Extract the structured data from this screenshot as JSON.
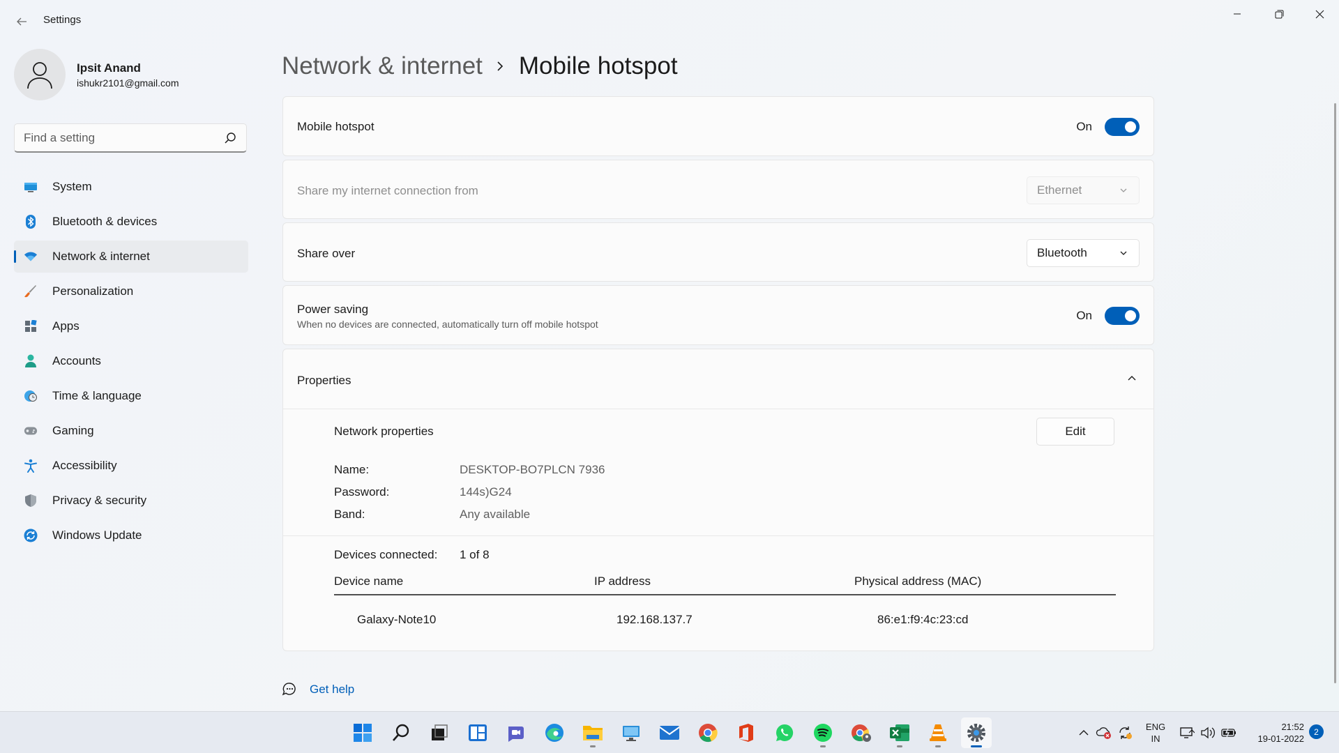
{
  "window": {
    "title": "Settings"
  },
  "profile": {
    "name": "Ipsit Anand",
    "email": "ishukr2101@gmail.com"
  },
  "search": {
    "placeholder": "Find a setting"
  },
  "nav": {
    "items": [
      {
        "label": "System",
        "icon": "monitor-icon"
      },
      {
        "label": "Bluetooth & devices",
        "icon": "bluetooth-icon"
      },
      {
        "label": "Network & internet",
        "icon": "wifi-icon",
        "active": true
      },
      {
        "label": "Personalization",
        "icon": "brush-icon"
      },
      {
        "label": "Apps",
        "icon": "apps-icon"
      },
      {
        "label": "Accounts",
        "icon": "person-icon"
      },
      {
        "label": "Time & language",
        "icon": "clock-globe-icon"
      },
      {
        "label": "Gaming",
        "icon": "gamepad-icon"
      },
      {
        "label": "Accessibility",
        "icon": "accessibility-icon"
      },
      {
        "label": "Privacy & security",
        "icon": "shield-icon"
      },
      {
        "label": "Windows Update",
        "icon": "update-icon"
      }
    ]
  },
  "breadcrumb": {
    "parent": "Network & internet",
    "current": "Mobile hotspot"
  },
  "hotspot": {
    "label": "Mobile hotspot",
    "state": "On"
  },
  "share_from": {
    "label": "Share my internet connection from",
    "value": "Ethernet"
  },
  "share_over": {
    "label": "Share over",
    "value": "Bluetooth"
  },
  "power_saving": {
    "label": "Power saving",
    "description": "When no devices are connected, automatically turn off mobile hotspot",
    "state": "On"
  },
  "properties": {
    "title": "Properties",
    "network_title": "Network properties",
    "edit_label": "Edit",
    "name_label": "Name:",
    "name_value": "DESKTOP-BO7PLCN 7936",
    "password_label": "Password:",
    "password_value": "144s)G24",
    "band_label": "Band:",
    "band_value": "Any available",
    "devices_label": "Devices connected:",
    "devices_value": "1 of 8",
    "columns": [
      "Device name",
      "IP address",
      "Physical address (MAC)"
    ],
    "rows": [
      {
        "device": "Galaxy-Note10",
        "ip": "192.168.137.7",
        "mac": "86:e1:f9:4c:23:cd"
      }
    ]
  },
  "help": {
    "label": "Get help"
  },
  "colors": {
    "accent": "#005fb8",
    "background": "#f3f5f8",
    "card": "#fbfbfb"
  },
  "taskbar": {
    "apps": [
      "start-icon",
      "search-icon",
      "task-view-icon",
      "widgets-icon",
      "teams-chat-icon",
      "edge-icon",
      "file-explorer-icon",
      "remote-desktop-icon",
      "mail-icon",
      "chrome-icon",
      "office-icon",
      "whatsapp-icon",
      "spotify-icon",
      "chrome-profile-icon",
      "excel-icon",
      "vlc-icon",
      "settings-icon"
    ],
    "language": {
      "line1": "ENG",
      "line2": "IN"
    },
    "time": "21:52",
    "date": "19-01-2022",
    "notifications": "2"
  }
}
